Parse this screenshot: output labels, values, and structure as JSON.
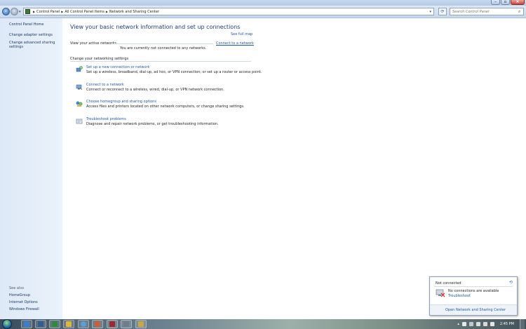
{
  "address_bar": {
    "crumbs": [
      "Control Panel",
      "All Control Panel Items",
      "Network and Sharing Center"
    ],
    "search_placeholder": "Search Control Panel"
  },
  "sidebar": {
    "home": "Control Panel Home",
    "items": [
      "Change adapter settings",
      "Change advanced sharing settings"
    ],
    "see_also_label": "See also",
    "see_also": [
      "HomeGroup",
      "Internet Options",
      "Windows Firewall"
    ]
  },
  "main": {
    "title": "View your basic network information and set up connections",
    "see_full_map": "See full map",
    "active_networks_label": "View your active networks",
    "connect_link": "Connect to a network",
    "no_networks": "You are currently not connected to any networks.",
    "settings_label": "Change your networking settings",
    "tasks": [
      {
        "title": "Set up a new connection or network",
        "desc": "Set up a wireless, broadband, dial-up, ad hoc, or VPN connection; or set up a router or access point.",
        "icon": "new-connection-icon"
      },
      {
        "title": "Connect to a network",
        "desc": "Connect or reconnect to a wireless, wired, dial-up, or VPN network connection.",
        "icon": "connect-network-icon"
      },
      {
        "title": "Choose homegroup and sharing options",
        "desc": "Access files and printers located on other network computers, or change sharing settings.",
        "icon": "homegroup-icon"
      },
      {
        "title": "Troubleshoot problems",
        "desc": "Diagnose and repair network problems, or get troubleshooting information.",
        "icon": "troubleshoot-icon"
      }
    ]
  },
  "flyout": {
    "title": "Not connected",
    "message": "No connections are available",
    "troubleshoot": "Troubleshoot",
    "open_center": "Open Network and Sharing Center"
  },
  "taskbar": {
    "clock": "2:45 PM"
  }
}
